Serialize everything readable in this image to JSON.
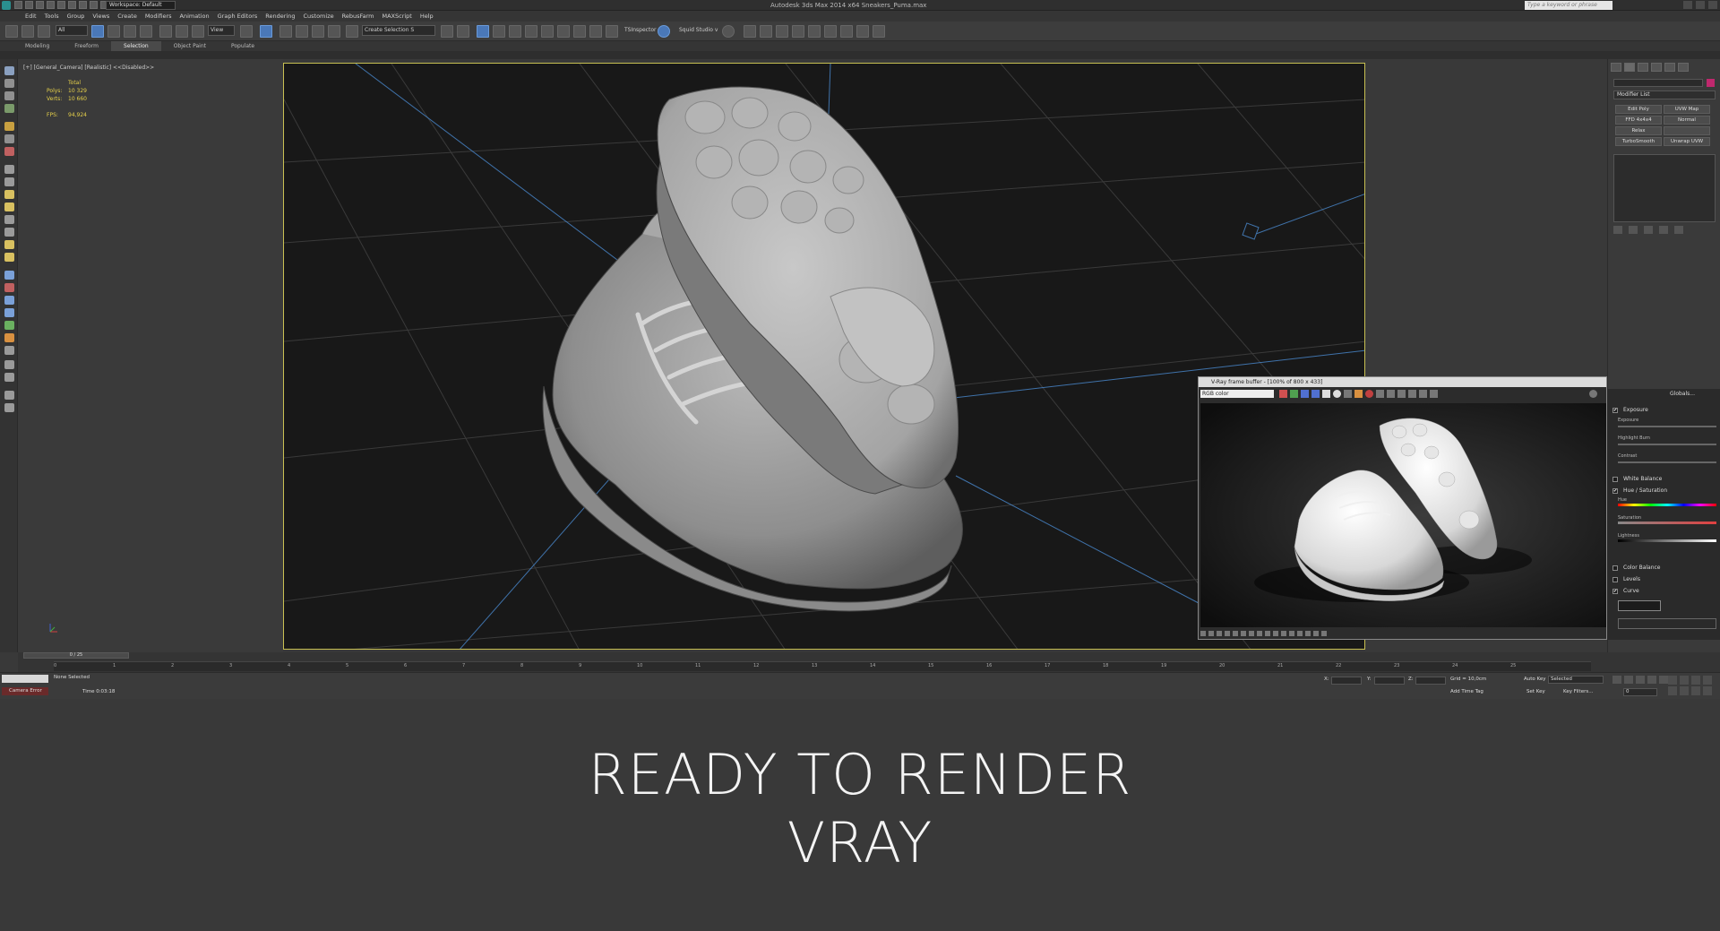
{
  "window": {
    "title": "Autodesk 3ds Max 2014 x64    Sneakers_Puma.max",
    "workspace": "Workspace: Default",
    "search_placeholder": "Type a keyword or phrase"
  },
  "menu": [
    "Edit",
    "Tools",
    "Group",
    "Views",
    "Create",
    "Modifiers",
    "Animation",
    "Graph Editors",
    "Rendering",
    "Customize",
    "RebusFarm",
    "MAXScript",
    "Help"
  ],
  "toolbar": {
    "filter": "All",
    "refcoord": "View",
    "selection_set": "Create Selection S",
    "plugin1": "TSInspector",
    "plugin2": "Squid Studio v"
  },
  "ribbon_tabs": [
    "Modeling",
    "Freeform",
    "Selection",
    "Object Paint",
    "Populate"
  ],
  "ribbon_active": "Selection",
  "viewport": {
    "label": "[+] [General_Camera] [Realistic] <<Disabled>>",
    "stats": {
      "total_label": "Total",
      "polys_label": "Polys:",
      "polys": "10 329",
      "verts_label": "Verts:",
      "verts": "10 660",
      "fps_label": "FPS:",
      "fps": "94,924"
    }
  },
  "modifier_panel": {
    "modifier_list": "Modifier List",
    "buttons": [
      "Edit Poly",
      "UVW Map",
      "FFD 4x4x4",
      "Normal",
      "Relax",
      "",
      "TurboSmooth",
      "Unwrap UVW"
    ]
  },
  "vfb": {
    "title": "V-Ray frame buffer - [100% of 800 x 433]",
    "channel": "RGB color",
    "globals": "Globals...",
    "corrections": [
      {
        "label": "Exposure",
        "checked": true
      },
      {
        "label": "White Balance",
        "checked": false
      },
      {
        "label": "Hue / Saturation",
        "checked": true
      },
      {
        "label": "Color Balance",
        "checked": false
      },
      {
        "label": "Levels",
        "checked": false
      },
      {
        "label": "Curve",
        "checked": true
      }
    ],
    "sub_labels": [
      "Exposure",
      "Highlight Burn",
      "Contrast",
      "Hue",
      "Saturation",
      "Lightness"
    ],
    "check_mark": "✔"
  },
  "timeline": {
    "slider": "0 / 25",
    "ticks": [
      "0",
      "1",
      "2",
      "3",
      "4",
      "5",
      "6",
      "7",
      "8",
      "9",
      "10",
      "11",
      "12",
      "13",
      "14",
      "15",
      "16",
      "17",
      "18",
      "19",
      "20",
      "21",
      "22",
      "23",
      "24",
      "25"
    ]
  },
  "status": {
    "camera": "Camera Error",
    "selection": "None Selected",
    "time": "Time  0:03:18",
    "x_label": "X:",
    "y_label": "Y:",
    "z_label": "Z:",
    "grid": "Grid = 10,0cm",
    "add_time_tag": "Add Time Tag",
    "auto_key": "Auto Key",
    "set_key": "Set Key",
    "selected": "Selected",
    "key_filters": "Key Filters...",
    "frame": "0"
  },
  "caption": {
    "line1": "READY TO RENDER",
    "line2": "VRAY"
  }
}
